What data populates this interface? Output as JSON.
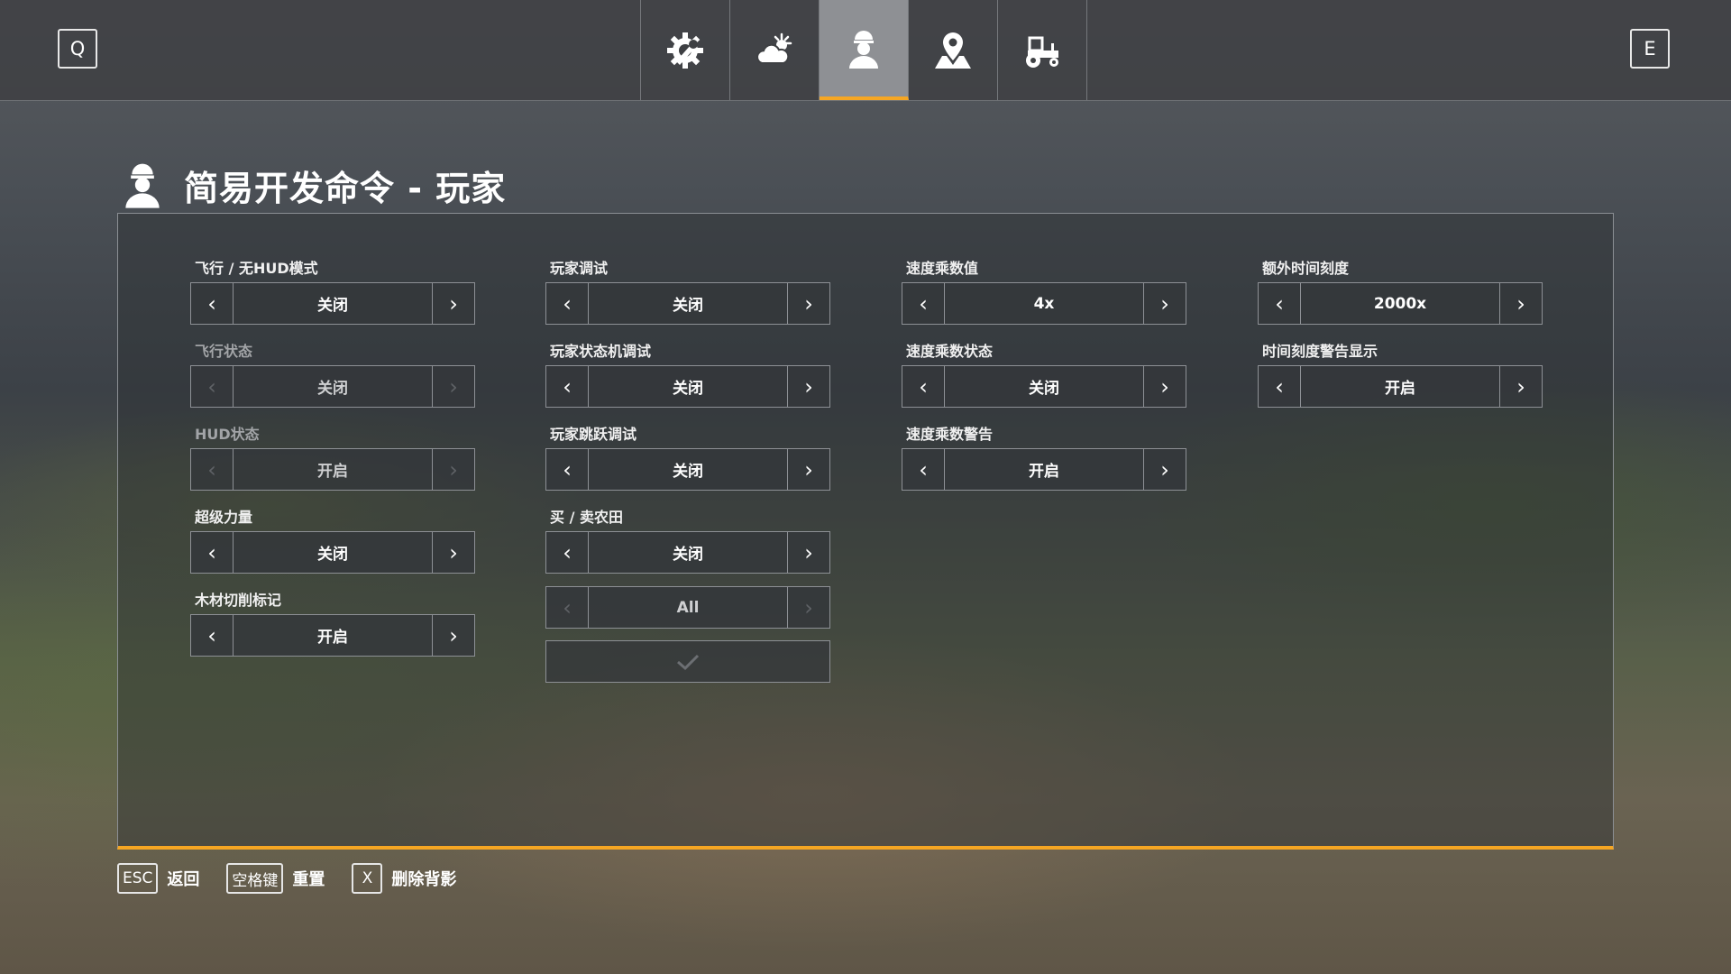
{
  "header": {
    "left_key": "Q",
    "right_key": "E",
    "tabs": [
      {
        "icon": "wrench-gear-icon"
      },
      {
        "icon": "weather-icon"
      },
      {
        "icon": "player-icon"
      },
      {
        "icon": "map-pin-icon"
      },
      {
        "icon": "tractor-icon"
      }
    ],
    "active_tab_index": 2,
    "accent_color": "#f5a623"
  },
  "page": {
    "title": "简易开发命令 - 玩家",
    "title_icon": "player-icon"
  },
  "settings": {
    "c1": [
      {
        "label": "飞行 / 无HUD模式",
        "value": "关闭",
        "enabled": true
      },
      {
        "label": "飞行状态",
        "value": "关闭",
        "enabled": false
      },
      {
        "label": "HUD状态",
        "value": "开启",
        "enabled": false
      },
      {
        "label": "超级力量",
        "value": "关闭",
        "enabled": true
      },
      {
        "label": "木材切削标记",
        "value": "开启",
        "enabled": true
      }
    ],
    "c2": [
      {
        "label": "玩家调试",
        "value": "关闭",
        "enabled": true
      },
      {
        "label": "玩家状态机调试",
        "value": "关闭",
        "enabled": true
      },
      {
        "label": "玩家跳跃调试",
        "value": "关闭",
        "enabled": true
      },
      {
        "label": "买 / 卖农田",
        "value": "关闭",
        "enabled": true
      }
    ],
    "c2_extra": {
      "value": "All",
      "enabled": false,
      "confirm_icon": "checkmark-icon"
    },
    "c3": [
      {
        "label": "速度乘数值",
        "value": "4x",
        "enabled": true
      },
      {
        "label": "速度乘数状态",
        "value": "关闭",
        "enabled": true
      },
      {
        "label": "速度乘数警告",
        "value": "开启",
        "enabled": true
      }
    ],
    "c4": [
      {
        "label": "额外时间刻度",
        "value": "2000x",
        "enabled": true
      },
      {
        "label": "时间刻度警告显示",
        "value": "开启",
        "enabled": true
      }
    ]
  },
  "footer": [
    {
      "key": "ESC",
      "label": "返回"
    },
    {
      "key": "空格键",
      "label": "重置"
    },
    {
      "key": "X",
      "label": "删除背影"
    }
  ]
}
